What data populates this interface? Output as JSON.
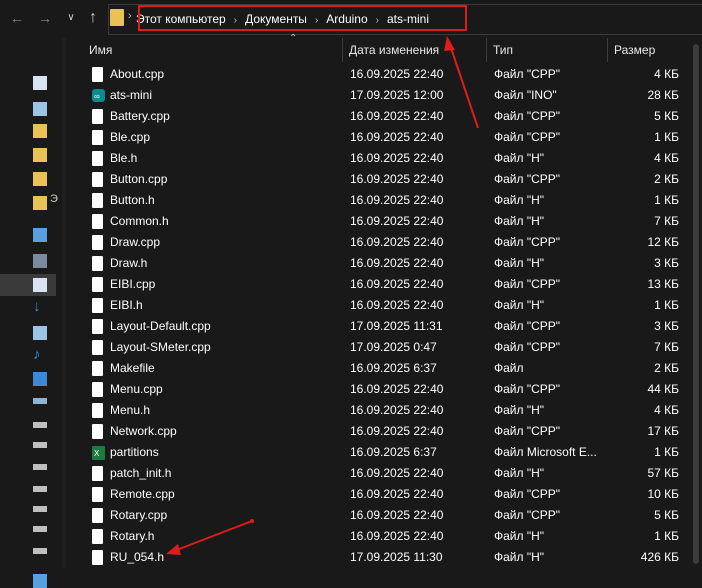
{
  "breadcrumbs": [
    "Этот компьютер",
    "Документы",
    "Arduino",
    "ats-mini"
  ],
  "columns": {
    "name": "Имя",
    "date": "Дата изменения",
    "type": "Тип",
    "size": "Размер"
  },
  "nav_icons": [
    "document-icon",
    "image-icon",
    "folder-icon",
    "folder-icon",
    "folder-icon",
    "folder-icon",
    "computer-icon",
    "film-icon",
    "document-icon",
    "download-icon",
    "image-icon",
    "music-icon",
    "desktop-icon",
    "network-drive-icon",
    "drive-icon",
    "drive-icon",
    "drive-icon",
    "drive-icon",
    "drive-icon",
    "drive-icon",
    "usb-drive-icon",
    "network-icon"
  ],
  "nav_label_partial": "Э",
  "colors": {
    "background": "#191919",
    "highlight": "#e01b1b",
    "folder": "#e8c257"
  },
  "files": [
    {
      "name": "About.cpp",
      "date": "16.09.2025 22:40",
      "type": "Файл \"CPP\"",
      "size": "4 КБ",
      "icon": "file-icon"
    },
    {
      "name": "ats-mini",
      "date": "17.09.2025 12:00",
      "type": "Файл \"INO\"",
      "size": "28 КБ",
      "icon": "arduino-icon"
    },
    {
      "name": "Battery.cpp",
      "date": "16.09.2025 22:40",
      "type": "Файл \"CPP\"",
      "size": "5 КБ",
      "icon": "file-icon"
    },
    {
      "name": "Ble.cpp",
      "date": "16.09.2025 22:40",
      "type": "Файл \"CPP\"",
      "size": "1 КБ",
      "icon": "file-icon"
    },
    {
      "name": "Ble.h",
      "date": "16.09.2025 22:40",
      "type": "Файл \"H\"",
      "size": "4 КБ",
      "icon": "file-icon"
    },
    {
      "name": "Button.cpp",
      "date": "16.09.2025 22:40",
      "type": "Файл \"CPP\"",
      "size": "2 КБ",
      "icon": "file-icon"
    },
    {
      "name": "Button.h",
      "date": "16.09.2025 22:40",
      "type": "Файл \"H\"",
      "size": "1 КБ",
      "icon": "file-icon"
    },
    {
      "name": "Common.h",
      "date": "16.09.2025 22:40",
      "type": "Файл \"H\"",
      "size": "7 КБ",
      "icon": "file-icon"
    },
    {
      "name": "Draw.cpp",
      "date": "16.09.2025 22:40",
      "type": "Файл \"CPP\"",
      "size": "12 КБ",
      "icon": "file-icon"
    },
    {
      "name": "Draw.h",
      "date": "16.09.2025 22:40",
      "type": "Файл \"H\"",
      "size": "3 КБ",
      "icon": "file-icon"
    },
    {
      "name": "EIBI.cpp",
      "date": "16.09.2025 22:40",
      "type": "Файл \"CPP\"",
      "size": "13 КБ",
      "icon": "file-icon"
    },
    {
      "name": "EIBI.h",
      "date": "16.09.2025 22:40",
      "type": "Файл \"H\"",
      "size": "1 КБ",
      "icon": "file-icon"
    },
    {
      "name": "Layout-Default.cpp",
      "date": "17.09.2025 11:31",
      "type": "Файл \"CPP\"",
      "size": "3 КБ",
      "icon": "file-icon"
    },
    {
      "name": "Layout-SMeter.cpp",
      "date": "17.09.2025 0:47",
      "type": "Файл \"CPP\"",
      "size": "7 КБ",
      "icon": "file-icon"
    },
    {
      "name": "Makefile",
      "date": "16.09.2025 6:37",
      "type": "Файл",
      "size": "2 КБ",
      "icon": "file-icon"
    },
    {
      "name": "Menu.cpp",
      "date": "16.09.2025 22:40",
      "type": "Файл \"CPP\"",
      "size": "44 КБ",
      "icon": "file-icon"
    },
    {
      "name": "Menu.h",
      "date": "16.09.2025 22:40",
      "type": "Файл \"H\"",
      "size": "4 КБ",
      "icon": "file-icon"
    },
    {
      "name": "Network.cpp",
      "date": "16.09.2025 22:40",
      "type": "Файл \"CPP\"",
      "size": "17 КБ",
      "icon": "file-icon"
    },
    {
      "name": "partitions",
      "date": "16.09.2025 6:37",
      "type": "Файл Microsoft E...",
      "size": "1 КБ",
      "icon": "excel-icon"
    },
    {
      "name": "patch_init.h",
      "date": "16.09.2025 22:40",
      "type": "Файл \"H\"",
      "size": "57 КБ",
      "icon": "file-icon"
    },
    {
      "name": "Remote.cpp",
      "date": "16.09.2025 22:40",
      "type": "Файл \"CPP\"",
      "size": "10 КБ",
      "icon": "file-icon"
    },
    {
      "name": "Rotary.cpp",
      "date": "16.09.2025 22:40",
      "type": "Файл \"CPP\"",
      "size": "5 КБ",
      "icon": "file-icon"
    },
    {
      "name": "Rotary.h",
      "date": "16.09.2025 22:40",
      "type": "Файл \"H\"",
      "size": "1 КБ",
      "icon": "file-icon"
    },
    {
      "name": "RU_054.h",
      "date": "17.09.2025 11:30",
      "type": "Файл \"H\"",
      "size": "426 КБ",
      "icon": "file-icon"
    }
  ]
}
